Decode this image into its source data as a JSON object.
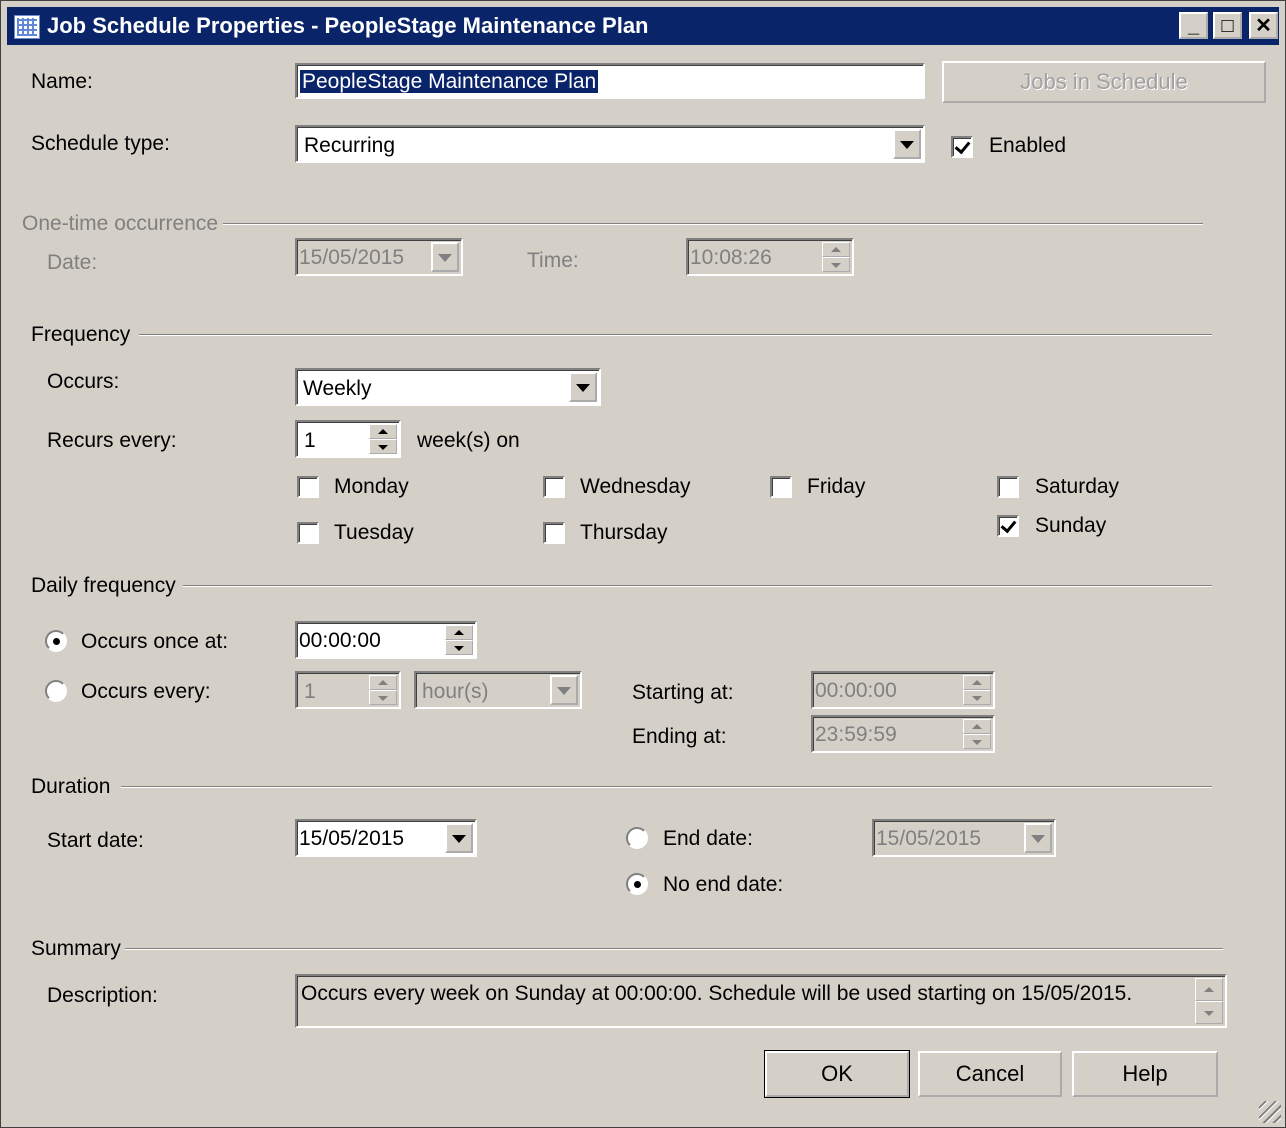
{
  "window": {
    "title": "Job Schedule Properties - PeopleStage Maintenance Plan",
    "minimize_glyph": "_",
    "maximize_glyph": "□",
    "close_glyph": "✕"
  },
  "name": {
    "label": "Name:",
    "value": "PeopleStage Maintenance Plan"
  },
  "jobs_in_schedule_button": "Jobs in Schedule",
  "schedule_type": {
    "label": "Schedule type:",
    "value": "Recurring"
  },
  "enabled": {
    "label": "Enabled",
    "checked": true
  },
  "one_time": {
    "group_label": "One-time occurrence",
    "date_label": "Date:",
    "date_value": "15/05/2015",
    "time_label": "Time:",
    "time_value": "10:08:26"
  },
  "frequency": {
    "group_label": "Frequency",
    "occurs_label": "Occurs:",
    "occurs_value": "Weekly",
    "recurs_label": "Recurs every:",
    "recurs_value": "1",
    "recurs_unit": "week(s) on",
    "days": {
      "monday": "Monday",
      "tuesday": "Tuesday",
      "wednesday": "Wednesday",
      "thursday": "Thursday",
      "friday": "Friday",
      "saturday": "Saturday",
      "sunday": "Sunday"
    },
    "checked_days": [
      "Sunday"
    ]
  },
  "daily_frequency": {
    "group_label": "Daily frequency",
    "once_label": "Occurs once at:",
    "once_value": "00:00:00",
    "every_label": "Occurs every:",
    "every_value": "1",
    "every_unit": "hour(s)",
    "starting_label": "Starting at:",
    "starting_value": "00:00:00",
    "ending_label": "Ending at:",
    "ending_value": "23:59:59",
    "selected": "once"
  },
  "duration": {
    "group_label": "Duration",
    "start_label": "Start date:",
    "start_value": "15/05/2015",
    "end_label": "End date:",
    "end_value": "15/05/2015",
    "no_end_label": "No end date:",
    "selected": "no_end"
  },
  "summary": {
    "group_label": "Summary",
    "description_label": "Description:",
    "description": "Occurs every week on Sunday at 00:00:00. Schedule will be used starting on 15/05/2015."
  },
  "buttons": {
    "ok": "OK",
    "cancel": "Cancel",
    "help": "Help"
  }
}
